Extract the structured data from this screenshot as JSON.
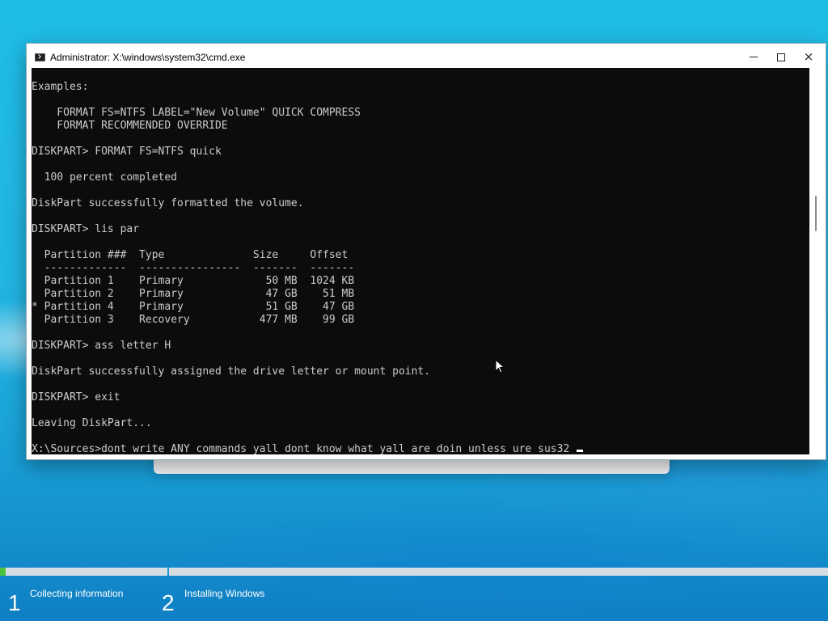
{
  "window": {
    "title": "Administrator: X:\\windows\\system32\\cmd.exe",
    "icon": "cmd-prompt-icon",
    "controls": {
      "minimize": "minimize-icon",
      "maximize": "maximize-icon",
      "close": "×"
    }
  },
  "console": {
    "lines": [
      "Examples:",
      "",
      "    FORMAT FS=NTFS LABEL=\"New Volume\" QUICK COMPRESS",
      "    FORMAT RECOMMENDED OVERRIDE",
      "",
      "DISKPART> FORMAT FS=NTFS quick",
      "",
      "  100 percent completed",
      "",
      "DiskPart successfully formatted the volume.",
      "",
      "DISKPART> lis par",
      "",
      "  Partition ###  Type              Size     Offset",
      "  -------------  ----------------  -------  -------",
      "  Partition 1    Primary             50 MB  1024 KB",
      "  Partition 2    Primary             47 GB    51 MB",
      "* Partition 4    Primary             51 GB    47 GB",
      "  Partition 3    Recovery           477 MB    99 GB",
      "",
      "DISKPART> ass letter H",
      "",
      "DiskPart successfully assigned the drive letter or mount point.",
      "",
      "DISKPART> exit",
      "",
      "Leaving DiskPart...",
      ""
    ],
    "prompt_line": "X:\\Sources>dont write ANY commands yall dont know what yall are doin unless ure sus32 ",
    "colors": {
      "background": "#0c0c0c",
      "foreground": "#cccccc"
    }
  },
  "setup": {
    "progress_fraction": 0.007,
    "steps": [
      {
        "number": "1",
        "label": "Collecting information"
      },
      {
        "number": "2",
        "label": "Installing Windows"
      }
    ],
    "colors": {
      "progress": "#4ec43c",
      "track": "#d6dde3"
    }
  }
}
